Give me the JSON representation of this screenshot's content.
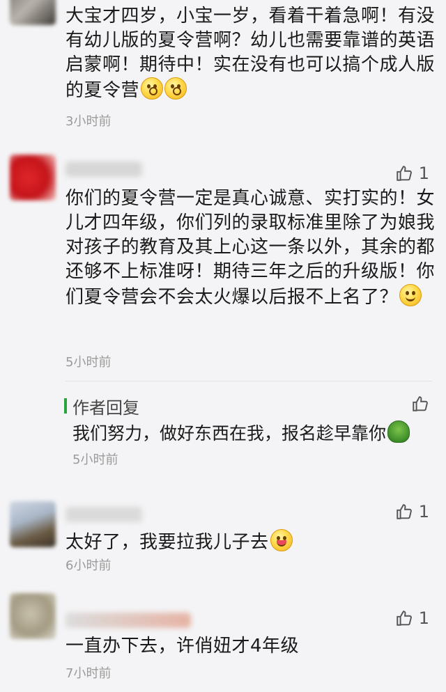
{
  "comments": [
    {
      "text": "大宝才四岁，小宝一岁，看着干着急啊！有没有幼儿版的夏令营啊？幼儿也需要靠谱的英语启蒙啊！期待中！实在没有也可以搞个成人版的夏令营",
      "emojis": [
        "dizzy-face-icon",
        "hushed-face-icon"
      ],
      "time": "3小时前"
    },
    {
      "likes": "1",
      "text": "你们的夏令营一定是真心诚意、实打实的！女儿才四年级，你们列的录取标准里除了为娘我对孩子的教育及其上心这一条以外，其余的都还够不上标准呀！期待三年之后的升级版！你们夏令营会不会太火爆以后报不上名了？",
      "emojis": [
        "grin-face-icon"
      ],
      "time": "5小时前",
      "reply": {
        "title": "作者回复",
        "text": "我们努力，做好东西在我，报名趁早靠你",
        "emojis": [
          "turtle-icon"
        ],
        "time": "5小时前"
      }
    },
    {
      "likes": "1",
      "text": "太好了，我要拉我儿子去",
      "emojis": [
        "wink-tongue-icon"
      ],
      "time": "6小时前"
    },
    {
      "likes": "1",
      "text": "一直办下去，许俏妞才4年级",
      "time": "7小时前"
    }
  ],
  "colors": {
    "reply_accent": "#2aa43a",
    "time": "#9a9a9a",
    "background": "#f4f4f6"
  }
}
